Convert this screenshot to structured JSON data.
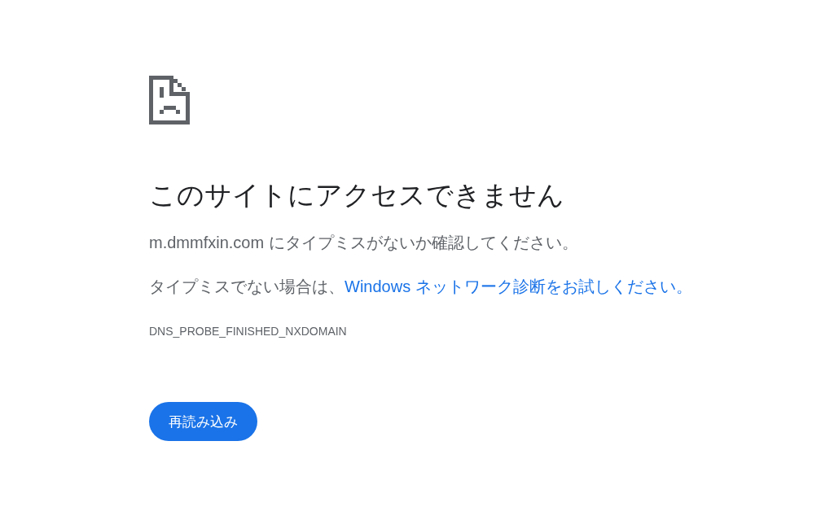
{
  "title": "このサイトにアクセスできません",
  "messages": [
    {
      "text": "m.dmmfxin.com にタイプミスがないか確認してください。"
    },
    {
      "text": "タイプミスでない場合は、",
      "link": "Windows ネットワーク診断をお試しください。"
    }
  ],
  "error_code": "DNS_PROBE_FINISHED_NXDOMAIN",
  "buttons": [
    {
      "label": "再読み込み"
    }
  ]
}
